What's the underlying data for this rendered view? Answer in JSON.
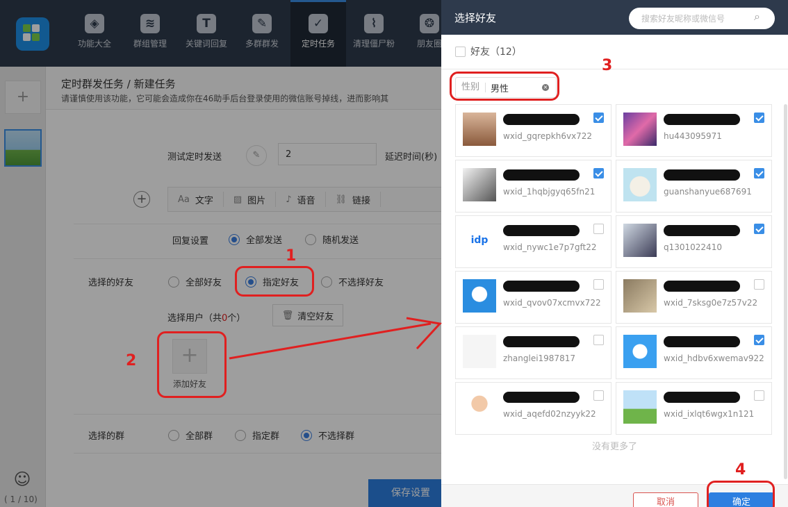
{
  "nav": {
    "items": [
      {
        "label": "功能大全",
        "icon": "cube-icon"
      },
      {
        "label": "群组管理",
        "icon": "layers-icon"
      },
      {
        "label": "关键词回复",
        "icon": "text-t-icon"
      },
      {
        "label": "多群群发",
        "icon": "edit-share-icon"
      },
      {
        "label": "定时任务",
        "icon": "calendar-check-icon",
        "active": true
      },
      {
        "label": "清理僵尸粉",
        "icon": "broom-icon"
      },
      {
        "label": "朋友圈",
        "icon": "aperture-icon"
      }
    ]
  },
  "leftrail": {
    "add_label": "+",
    "page_indicator": "( 1 / 10)"
  },
  "main": {
    "breadcrumb": "定时群发任务 / 新建任务",
    "warning": "请谨慎使用该功能，它可能会造成你在46助手后台登录使用的微信账号掉线，进而影响其",
    "test_send_label": "测试定时发送",
    "delay_value": "2",
    "delay_label": "延迟时间(秒)",
    "toolbar": [
      "文字",
      "图片",
      "语音",
      "链接"
    ],
    "reply_settings": {
      "label": "回复设置",
      "options": [
        "全部发送",
        "随机发送"
      ],
      "selected": 0
    },
    "friend_select": {
      "label": "选择的好友",
      "options": [
        "全部好友",
        "指定好友",
        "不选择好友"
      ],
      "selected": 1
    },
    "select_users": {
      "prefix": "选择用户（共",
      "count": "0",
      "suffix": "个）"
    },
    "clear_friends": "清空好友",
    "add_friend": "添加好友",
    "group_select": {
      "label": "选择的群",
      "options": [
        "全部群",
        "指定群",
        "不选择群"
      ],
      "selected": 2
    },
    "save": "保存设置"
  },
  "modal": {
    "title": "选择好友",
    "search_placeholder": "搜索好友昵称或微信号",
    "select_all": {
      "label": "好友（12）",
      "checked": false
    },
    "filter": {
      "label": "性别",
      "value": "男性"
    },
    "friends": [
      {
        "name": "",
        "wxid": "wxid_gqrepkh6vx722",
        "checked": true
      },
      {
        "name": "",
        "wxid": "hu443095971",
        "checked": true
      },
      {
        "name": "",
        "wxid": "wxid_1hqbjgyq65fn21",
        "checked": true
      },
      {
        "name": "",
        "wxid": "guanshanyue687691",
        "checked": true
      },
      {
        "name": "",
        "wxid": "wxid_nywc1e7p7gft22",
        "checked": false
      },
      {
        "name": "",
        "wxid": "q1301022410",
        "checked": true
      },
      {
        "name": "",
        "wxid": "wxid_qvov07xcmvx722",
        "checked": false
      },
      {
        "name": "",
        "wxid": "wxid_7sksg0e7z57v22",
        "checked": false
      },
      {
        "name": "",
        "wxid": "zhanglei1987817",
        "checked": false
      },
      {
        "name": "",
        "wxid": "wxid_hdbv6xwemav922",
        "checked": true
      },
      {
        "name": "",
        "wxid": "wxid_aqefd02nzyyk22",
        "checked": false
      },
      {
        "name": "",
        "wxid": "wxid_ixlqt6wgx1n121",
        "checked": false
      }
    ],
    "no_more": "没有更多了",
    "cancel": "取消",
    "confirm": "确定"
  },
  "annotations": [
    "1",
    "2",
    "3",
    "4"
  ],
  "colors": {
    "accent": "#2d7fe0",
    "header": "#2e3a4c",
    "annotation": "#e02020"
  }
}
